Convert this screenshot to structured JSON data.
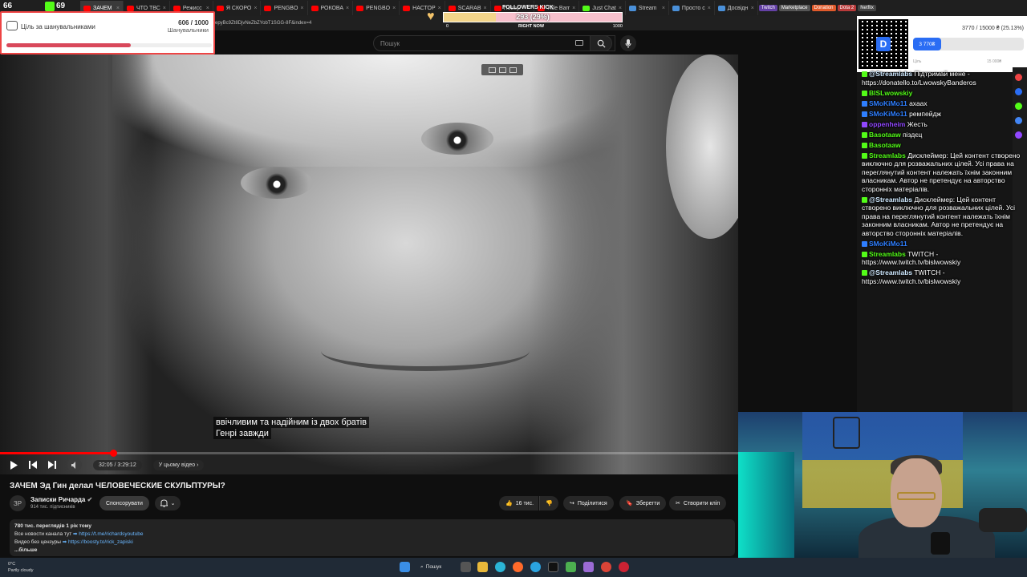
{
  "tabs": [
    {
      "label": "ЗАЧЕМ",
      "type": "yt"
    },
    {
      "label": "ЧТО ТВС",
      "type": "yt"
    },
    {
      "label": "Режисс",
      "type": "yt"
    },
    {
      "label": "Я СКОРО",
      "type": "yt"
    },
    {
      "label": "PENGBO",
      "type": "yt"
    },
    {
      "label": "РОКОВА",
      "type": "yt"
    },
    {
      "label": "PENGBO",
      "type": "yt"
    },
    {
      "label": "НАСТОР",
      "type": "yt"
    },
    {
      "label": "SCARAB",
      "type": "yt"
    },
    {
      "label": "Повер",
      "type": "yt"
    },
    {
      "label": "Tide Barr",
      "type": "yt"
    },
    {
      "label": "Just Chat",
      "type": "kick"
    },
    {
      "label": "Stream",
      "type": "other"
    },
    {
      "label": "Просто с",
      "type": "other"
    },
    {
      "label": "Досвідн",
      "type": "other"
    }
  ],
  "tab_pills": [
    {
      "label": "Twitch",
      "color": "#6441a5"
    },
    {
      "label": "Marketplace",
      "color": "#555555"
    },
    {
      "label": "Donation",
      "color": "#e05a2b"
    },
    {
      "label": "Dota 2",
      "color": "#b83a3a"
    },
    {
      "label": "Netflix",
      "color": "#444444"
    }
  ],
  "overlay_counts": {
    "left": "66",
    "right": "69"
  },
  "address_bar": "epyBc9Zt8DjvNeZbZYobT1SGG-8F&index=4",
  "search": {
    "placeholder": "Пошук"
  },
  "goal": {
    "title": "Ціль за шанувальниками",
    "count": "606",
    "total": "/ 1000",
    "unit": "Шанувальники",
    "progress": 0.606
  },
  "followers": {
    "label": "FOLLOWERS KICK",
    "value": "293 (29%)",
    "start": "0",
    "mid": "RIGHT NOW",
    "end": "1000",
    "progress": 0.293
  },
  "donation": {
    "amount_text": "3770 / 15000 ₴ (25.13%)",
    "bar_label": "3 770₴",
    "left_label": "Ціль",
    "right_label": "15 000₴",
    "progress": 0.2513
  },
  "video": {
    "subtitle_line1": "ввічливим та надійним із двох братів",
    "subtitle_line2": "Генрі завжди",
    "time": "32:05 / 3:29:12",
    "chapter": "У цьому відео",
    "progress": 0.153
  },
  "title": "ЗАЧЕМ Эд Гин делал ЧЕЛОВЕЧЕСКИЕ СКУЛЬПТУРЫ?",
  "channel": {
    "avatar_text": "ЗР",
    "name": "Записки Ричарда",
    "subs": "914 тис. підписників",
    "sponsor": "Спонсорувати"
  },
  "actions": {
    "likes": "16 тис.",
    "share": "Поділитися",
    "save": "Зберегти",
    "clip": "Створити кліп"
  },
  "description": {
    "meta": "780 тис. переглядів  1 рік тому",
    "line1": "Все новости канала тут",
    "link1": "https://t.me/richardsyoutube",
    "line2": "Видео без цензуры",
    "link2": "https://boosty.to/rick_zapiski",
    "more": "...більше"
  },
  "chat": [
    {
      "user": "@Streamlabs",
      "text": "Підтримай мене - https://donatello.to/LwowskyBanderos",
      "color": "#cfe9ff"
    },
    {
      "user": "BISLwowskiy",
      "text": "",
      "color": "#53fc18"
    },
    {
      "user": "SMoKiMo11",
      "text": "ахаах",
      "color": "#2f7fff"
    },
    {
      "user": "SMoKiMo11",
      "text": "ремпейдж",
      "color": "#2f7fff"
    },
    {
      "user": "oppenheim",
      "text": "Жесть",
      "color": "#9147ff"
    },
    {
      "user": "Basotaaw",
      "text": "піздєц",
      "color": "#53fc18"
    },
    {
      "user": "Basotaaw",
      "text": "",
      "color": "#53fc18"
    },
    {
      "user": "Streamlabs",
      "text": "Дисклеймер: Цей контент створено виключно для розважальних цілей. Усі права на переглянутий контент належать їхнім законним власникам. Автор не претендує на авторство сторонніх матеріалів.",
      "color": "#53fc18"
    },
    {
      "user": "@Streamlabs",
      "text": "Дисклеймер: Цей контент створено виключно для розважальних цілей. Усі права на переглянутий контент належать їхнім законним власникам. Автор не претендує на авторство сторонніх матеріалів.",
      "color": "#cfe9ff"
    },
    {
      "user": "SMoKiMo11",
      "text": "",
      "color": "#2f7fff"
    },
    {
      "user": "Streamlabs",
      "text": "TWITCH - https://www.twitch.tv/bislwowskiy",
      "color": "#53fc18"
    },
    {
      "user": "@Streamlabs",
      "text": "TWITCH - https://www.twitch.tv/bislwowskiy",
      "color": "#cfe9ff"
    }
  ],
  "taskbar": {
    "temp": "0°C",
    "weather": "Partly cloudy",
    "search": "Пошук"
  },
  "colors": {
    "accent": "#ff0000",
    "kick": "#53fc18",
    "donation": "#2a6df4"
  }
}
